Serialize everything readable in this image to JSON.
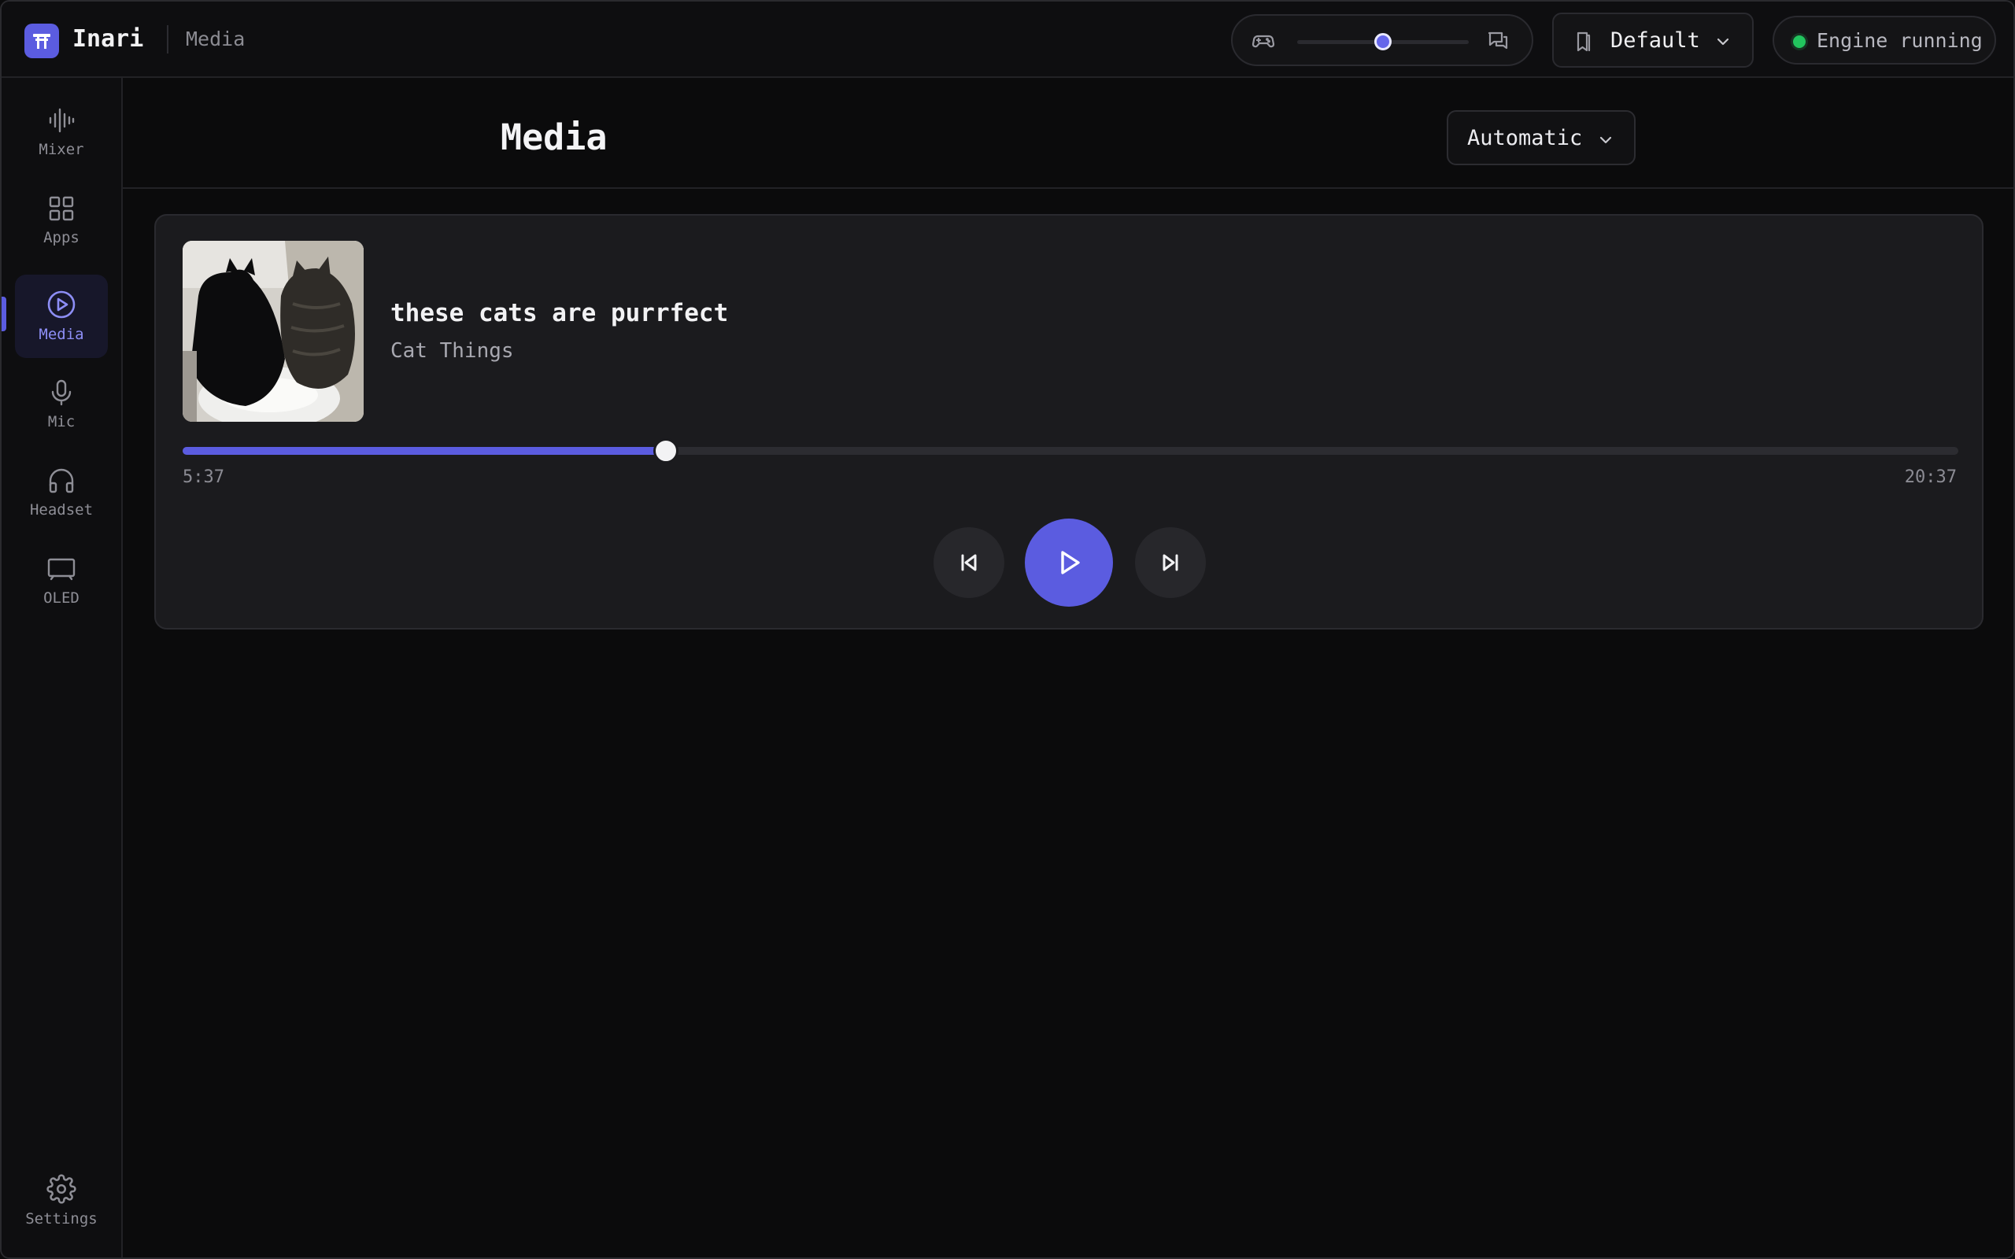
{
  "app": {
    "name": "Inari",
    "breadcrumb": "Media"
  },
  "topbar": {
    "balance": {
      "left_icon": "gamepad-icon",
      "right_icon": "chat-icon",
      "value": 0.5
    },
    "profile": {
      "label": "Default",
      "icon": "bookmark-icon"
    },
    "engine": {
      "label": "Engine running",
      "status_color": "#22c55e"
    }
  },
  "sidebar": {
    "items": [
      {
        "id": "mixer",
        "label": "Mixer",
        "icon": "waveform-icon",
        "active": false
      },
      {
        "id": "apps",
        "label": "Apps",
        "icon": "grid-icon",
        "active": false
      },
      {
        "id": "media",
        "label": "Media",
        "icon": "play-circle-icon",
        "active": true
      },
      {
        "id": "mic",
        "label": "Mic",
        "icon": "microphone-icon",
        "active": false
      },
      {
        "id": "headset",
        "label": "Headset",
        "icon": "headphones-icon",
        "active": false
      },
      {
        "id": "oled",
        "label": "OLED",
        "icon": "display-icon",
        "active": false
      }
    ],
    "settings": {
      "label": "Settings",
      "icon": "gear-icon"
    }
  },
  "main": {
    "title": "Media",
    "mode": {
      "label": "Automatic"
    }
  },
  "player": {
    "title": "these cats are purrfect",
    "artist": "Cat Things",
    "elapsed": "5:37",
    "duration": "20:37",
    "progress": 0.272,
    "state": "paused"
  },
  "colors": {
    "accent": "#5b5ce0",
    "background": "#0b0b0c",
    "card": "#1b1b1e",
    "active_nav_text": "#8d8ef5"
  }
}
